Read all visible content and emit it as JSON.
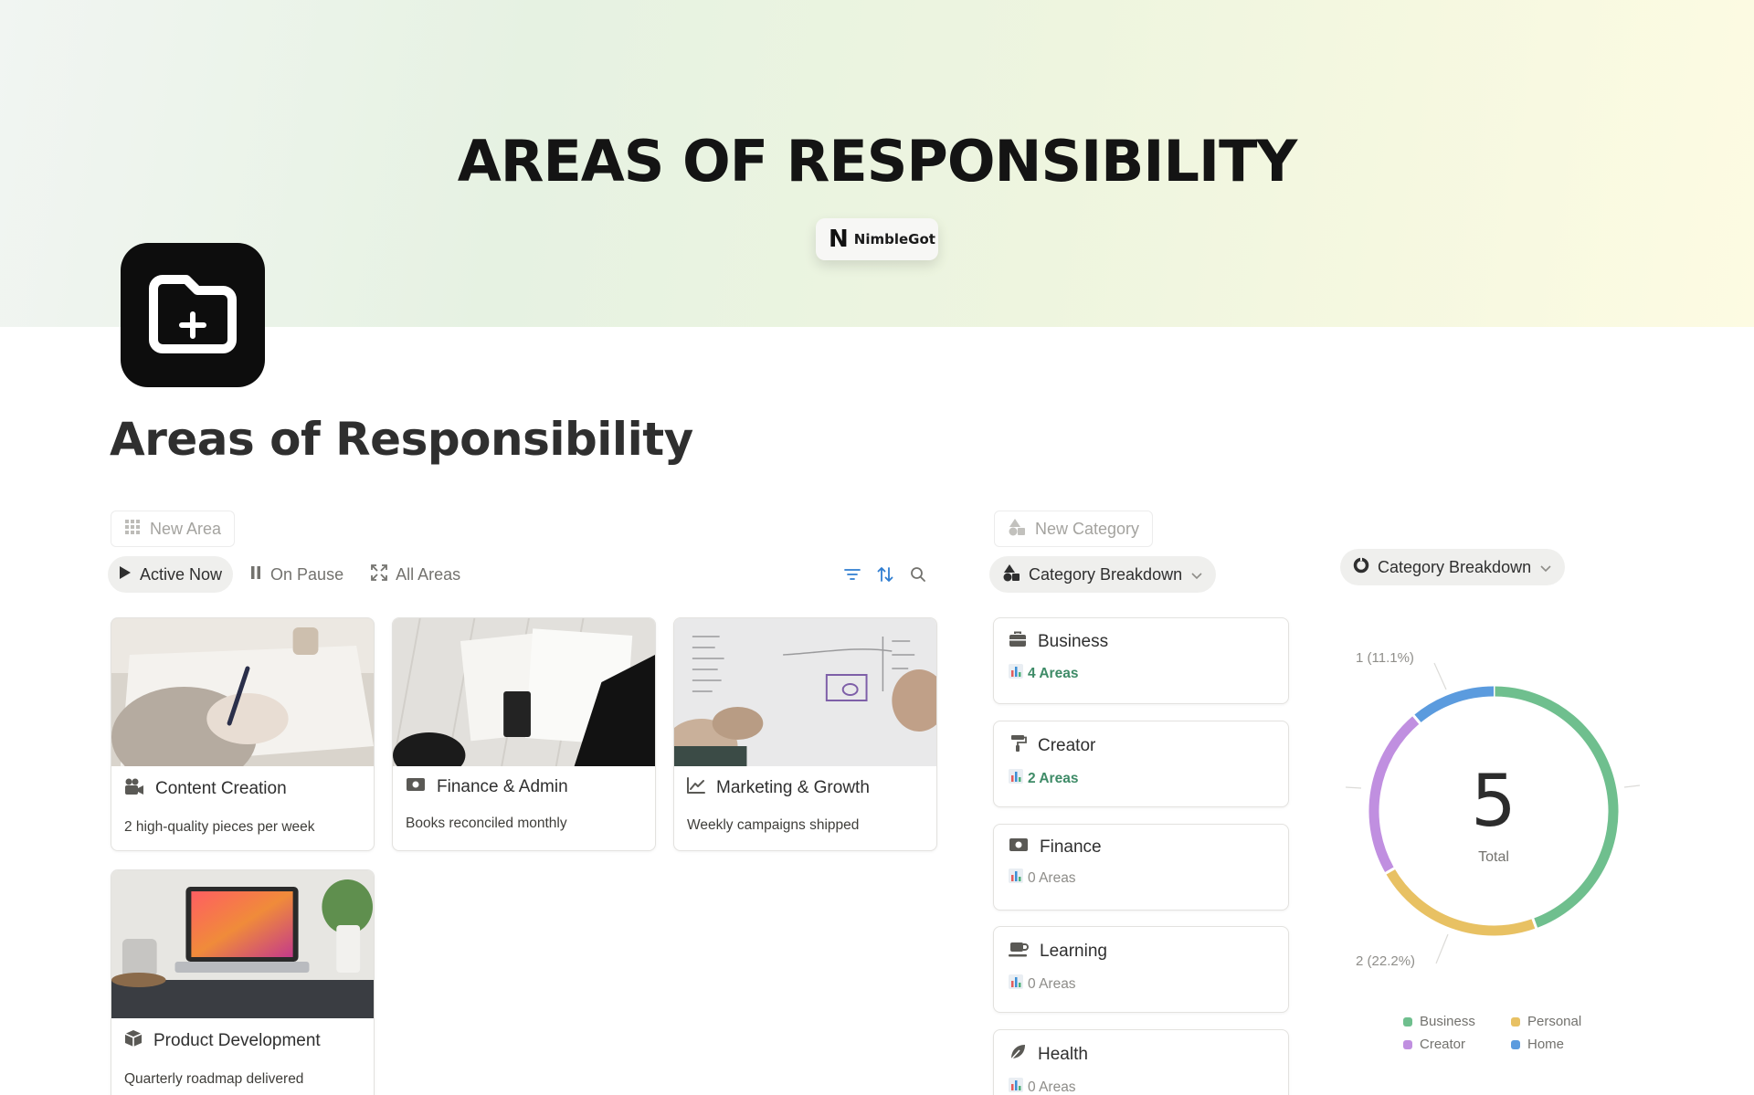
{
  "cover": {
    "title": "AREAS OF RESPONSIBILITY",
    "brand_logo": "N",
    "brand_name": "NimbleGot"
  },
  "page": {
    "title": "Areas of Responsibility",
    "icon": "folder-plus-icon"
  },
  "areas": {
    "new_label": "New Area",
    "tabs": [
      {
        "label": "Active Now",
        "icon": "play-icon",
        "active": true
      },
      {
        "label": "On Pause",
        "icon": "pause-icon",
        "active": false
      },
      {
        "label": "All Areas",
        "icon": "expand-icon",
        "active": false
      }
    ],
    "tools": [
      "filter-icon",
      "sort-icon",
      "search-icon"
    ],
    "cards": [
      {
        "title": "Content Creation",
        "icon": "video-camera-icon",
        "desc": "2 high-quality pieces per week",
        "image": "hand-writing-photo"
      },
      {
        "title": "Finance & Admin",
        "icon": "money-icon",
        "desc": "Books reconciled monthly",
        "image": "calculator-documents-photo"
      },
      {
        "title": "Marketing & Growth",
        "icon": "chart-up-icon",
        "desc": "Weekly campaigns shipped",
        "image": "whiteboard-photo"
      },
      {
        "title": "Product Development",
        "icon": "box-icon",
        "desc": "Quarterly roadmap delivered",
        "image": "laptop-desk-photo"
      }
    ]
  },
  "categories": {
    "new_label": "New Category",
    "view_label": "Category Breakdown",
    "items": [
      {
        "name": "Business",
        "icon": "briefcase-icon",
        "count": "4 Areas"
      },
      {
        "name": "Creator",
        "icon": "paint-roller-icon",
        "count": "2 Areas"
      },
      {
        "name": "Finance",
        "icon": "money-icon",
        "count": "0 Areas"
      },
      {
        "name": "Learning",
        "icon": "coffee-cup-icon",
        "count": "0 Areas"
      },
      {
        "name": "Health",
        "icon": "leaf-icon",
        "count": "0 Areas"
      }
    ]
  },
  "chart_panel": {
    "view_label": "Category Breakdown",
    "total_value": "5",
    "total_label": "Total",
    "label_top": "1 (11.1%)",
    "label_bottom": "2 (22.2%)"
  },
  "chart_data": {
    "type": "pie",
    "categories": [
      "Business",
      "Personal",
      "Creator",
      "Home"
    ],
    "values": [
      4,
      2,
      2,
      1
    ],
    "colors": [
      "#6fbf8e",
      "#e8c163",
      "#c08fe0",
      "#5b9bde"
    ],
    "center_value": 5,
    "center_label": "Total",
    "legend": "bottom"
  }
}
